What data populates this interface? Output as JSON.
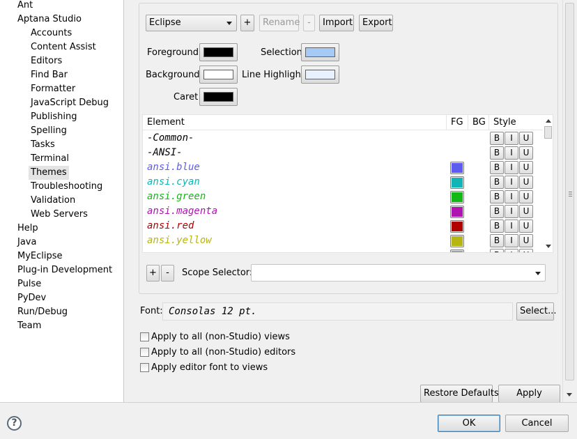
{
  "tree": {
    "items": [
      {
        "label": "Ant",
        "level": 0
      },
      {
        "label": "Aptana Studio",
        "level": 0
      },
      {
        "label": "Accounts",
        "level": 1
      },
      {
        "label": "Content Assist",
        "level": 1
      },
      {
        "label": "Editors",
        "level": 1
      },
      {
        "label": "Find Bar",
        "level": 1
      },
      {
        "label": "Formatter",
        "level": 1
      },
      {
        "label": "JavaScript Debug",
        "level": 1
      },
      {
        "label": "Publishing",
        "level": 1
      },
      {
        "label": "Spelling",
        "level": 1
      },
      {
        "label": "Tasks",
        "level": 1
      },
      {
        "label": "Terminal",
        "level": 1
      },
      {
        "label": "Themes",
        "level": 1,
        "selected": true
      },
      {
        "label": "Troubleshooting",
        "level": 1
      },
      {
        "label": "Validation",
        "level": 1
      },
      {
        "label": "Web Servers",
        "level": 1
      },
      {
        "label": "Help",
        "level": 0
      },
      {
        "label": "Java",
        "level": 0
      },
      {
        "label": "MyEclipse",
        "level": 0
      },
      {
        "label": "Plug-in Development",
        "level": 0
      },
      {
        "label": "Pulse",
        "level": 0
      },
      {
        "label": "PyDev",
        "level": 0
      },
      {
        "label": "Run/Debug",
        "level": 0
      },
      {
        "label": "Team",
        "level": 0
      }
    ]
  },
  "theme": {
    "selected": "Eclipse",
    "add_label": "+",
    "rename_label": "Rename",
    "remove_label": "-",
    "import_label": "Import",
    "export_label": "Export"
  },
  "colors": {
    "foreground_label": "Foreground",
    "foreground_color": "#000000",
    "selection_label": "Selection",
    "selection_color": "#a6caf6",
    "background_label": "Background",
    "background_color": "#ffffff",
    "line_highlight_label": "Line Highlight",
    "line_highlight_color": "#e8f2fe",
    "caret_label": "Caret",
    "caret_color": "#000000"
  },
  "table": {
    "headers": {
      "element": "Element",
      "fg": "FG",
      "bg": "BG",
      "style": "Style"
    },
    "style_buttons": {
      "bold": "B",
      "italic": "I",
      "underline": "U"
    },
    "rows": [
      {
        "name": "-Common-",
        "text_color": "#000000",
        "fg": null
      },
      {
        "name": "-ANSI-",
        "text_color": "#000000",
        "fg": null
      },
      {
        "name": "ansi.blue",
        "text_color": "#5c5cf0",
        "fg": "#5c5cf0"
      },
      {
        "name": "ansi.cyan",
        "text_color": "#11b5b5",
        "fg": "#11b5b5"
      },
      {
        "name": "ansi.green",
        "text_color": "#14b814",
        "fg": "#14b814"
      },
      {
        "name": "ansi.magenta",
        "text_color": "#b014b0",
        "fg": "#b014b0"
      },
      {
        "name": "ansi.red",
        "text_color": "#b00000",
        "fg": "#b00000"
      },
      {
        "name": "ansi.yellow",
        "text_color": "#b5b514",
        "fg": "#b5b514"
      },
      {
        "name": "",
        "text_color": "#808080",
        "fg": "#a0a0a0"
      }
    ]
  },
  "scope": {
    "add_label": "+",
    "remove_label": "-",
    "label": "Scope Selector:",
    "value": ""
  },
  "font": {
    "label": "Font:",
    "value": "Consolas 12 pt.",
    "select_label": "Select..."
  },
  "options": [
    {
      "label": "Apply to all (non-Studio) views",
      "checked": false
    },
    {
      "label": "Apply to all (non-Studio) editors",
      "checked": false
    },
    {
      "label": "Apply editor font to views",
      "checked": false
    }
  ],
  "page_buttons": {
    "restore_defaults": "Restore Defaults",
    "apply": "Apply"
  },
  "dialog": {
    "help_icon": "?",
    "ok": "OK",
    "cancel": "Cancel"
  }
}
